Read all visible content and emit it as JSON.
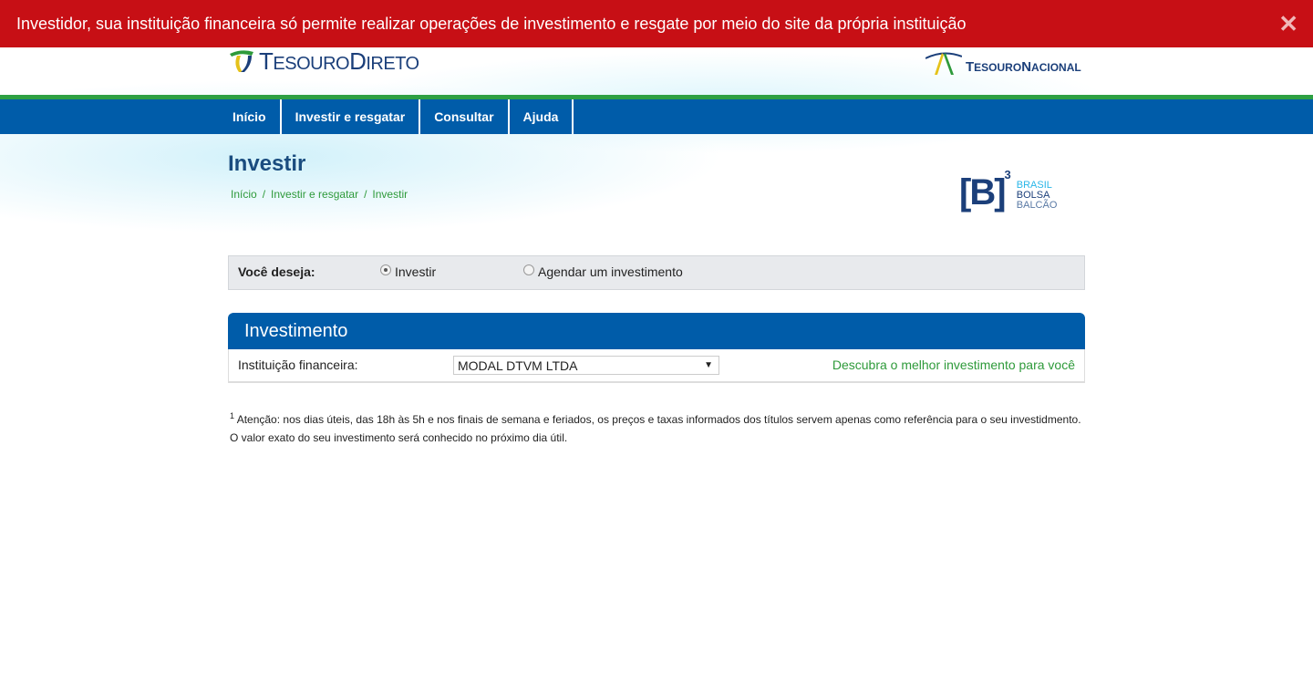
{
  "alert": {
    "text": "Investidor, sua instituição financeira só permite realizar operações de investimento e resgate por meio do site da própria instituição",
    "close": "✕"
  },
  "header": {
    "logo_left_a": "T",
    "logo_left_b": "ESOURO",
    "logo_left_c": "D",
    "logo_left_d": "IRETO",
    "logo_right_a": "T",
    "logo_right_b": "ESOURO",
    "logo_right_c": "N",
    "logo_right_d": "ACIONAL"
  },
  "nav": {
    "items": [
      {
        "label": "Início"
      },
      {
        "label": "Investir e resgatar"
      },
      {
        "label": "Consultar"
      },
      {
        "label": "Ajuda"
      }
    ]
  },
  "page": {
    "title": "Investir",
    "breadcrumb": [
      "Início",
      "Investir e resgatar",
      "Investir"
    ],
    "breadcrumb_sep": "/"
  },
  "b3": {
    "mark": "[B]",
    "sup": "3",
    "line1": "BRASIL",
    "line2": "BOLSA",
    "line3": "BALCÃO",
    "colors": {
      "navy": "#1b3f7a",
      "cyan": "#29b6e8"
    }
  },
  "choice": {
    "label": "Você deseja:",
    "options": [
      {
        "label": "Investir",
        "selected": true
      },
      {
        "label": "Agendar um investimento",
        "selected": false
      }
    ]
  },
  "panel": {
    "title": "Investimento",
    "field_label": "Instituição financeira:",
    "select_value": "MODAL DTVM LTDA",
    "link": "Descubra o melhor investimento para você"
  },
  "note": {
    "sup": "1",
    "text": " Atenção: nos dias úteis, das 18h às 5h e nos finais de semana e feriados, os preços e taxas informados dos títulos servem apenas como referência para o seu investidmento. O valor exato do seu investimento será conhecido no próximo dia útil."
  },
  "colors": {
    "alert": "#c70f15",
    "nav": "#005ca9",
    "green": "#2ea043"
  }
}
